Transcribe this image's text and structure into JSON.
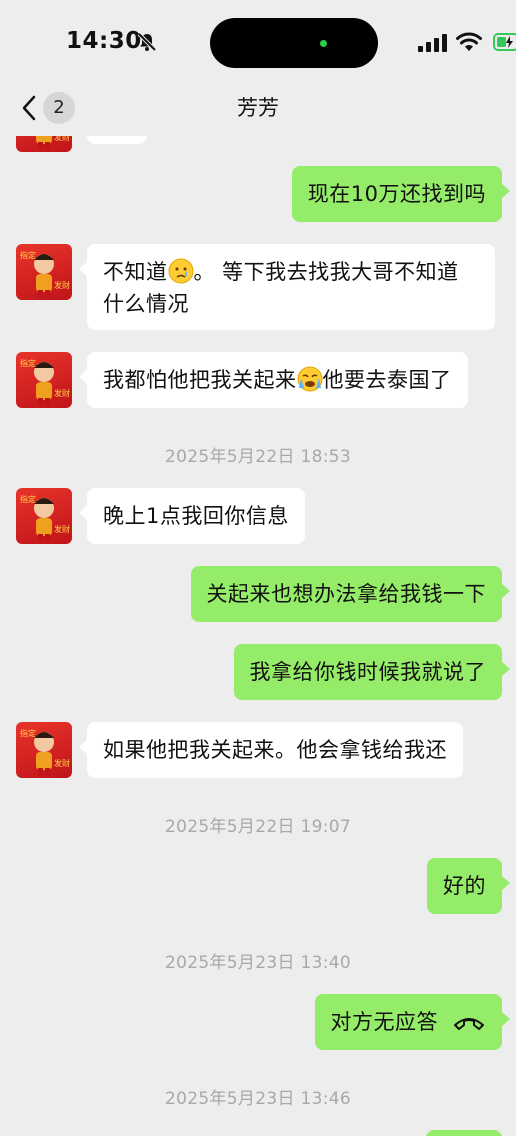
{
  "status_bar": {
    "time": "14:30"
  },
  "nav": {
    "unread_count": "2",
    "title": "芳芳"
  },
  "messages": {
    "m1": "现在10万还找到吗",
    "m2a": "不知道",
    "m2b": "。 等下我去找我大哥不知道什么情况",
    "m3a": "我都怕他把我关起来",
    "m3b": "他要去泰国了",
    "ts1": "2025年5月22日 18:53",
    "m4": "晚上1点我回你信息",
    "m5": "关起来也想办法拿给我钱一下",
    "m6": "我拿给你钱时候我就说了",
    "m7": "如果他把我关起来。他会拿钱给我还",
    "ts2": "2025年5月22日 19:07",
    "m8": "好的",
    "ts3": "2025年5月23日 13:40",
    "m9": "对方无应答",
    "ts4": "2025年5月23日 13:46"
  },
  "icons": {
    "bell": "bell-slash-icon",
    "signal": "cellular-signal-icon",
    "wifi": "wifi-icon",
    "battery": "battery-charging-icon",
    "back": "chevron-left-icon",
    "emoji1": "crying-face-emoji",
    "emoji2": "loudly-crying-face-emoji",
    "call": "hang-up-phone-icon"
  },
  "colors": {
    "background": "#ededed",
    "outgoing_bubble": "#95ec69",
    "incoming_bubble": "#ffffff",
    "timestamp": "#a8a8a8",
    "avatar_red": "#d42020"
  }
}
